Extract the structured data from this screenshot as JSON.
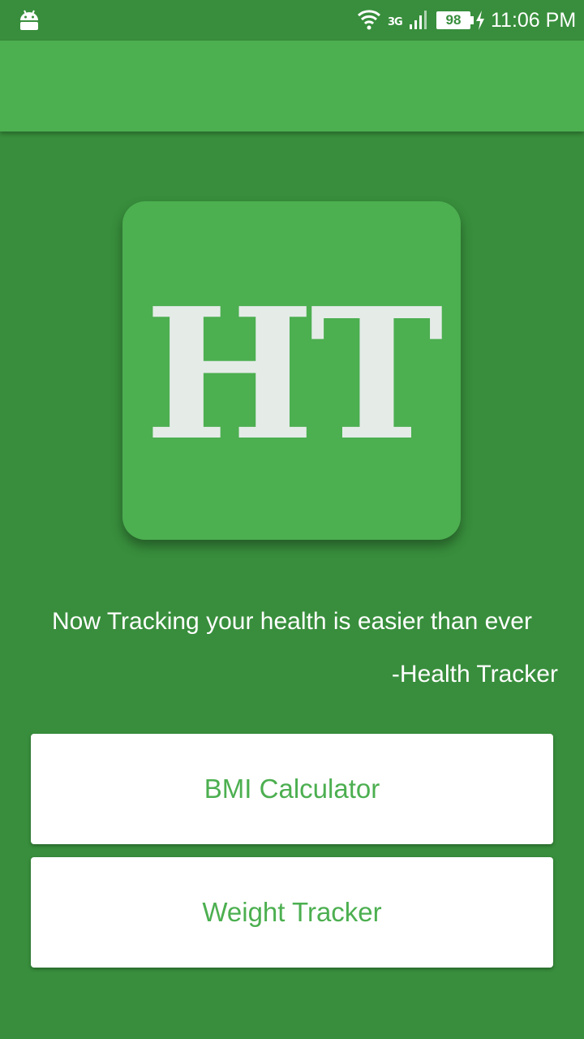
{
  "status_bar": {
    "network": "3G",
    "battery": "98",
    "time": "11:06 PM",
    "icons": [
      "android-icon",
      "wifi-icon",
      "signal-icon",
      "battery-icon",
      "charging-icon"
    ]
  },
  "logo": {
    "text": "HT"
  },
  "quote": {
    "text": "Now Tracking your health is easier than ever",
    "attribution": "-Health Tracker"
  },
  "buttons": {
    "bmi": "BMI Calculator",
    "weight": "Weight Tracker"
  },
  "colors": {
    "background": "#388e3c",
    "primary": "#4caf50",
    "button_bg": "#ffffff",
    "button_text": "#4caf50",
    "logo_text": "#e5ece8"
  }
}
